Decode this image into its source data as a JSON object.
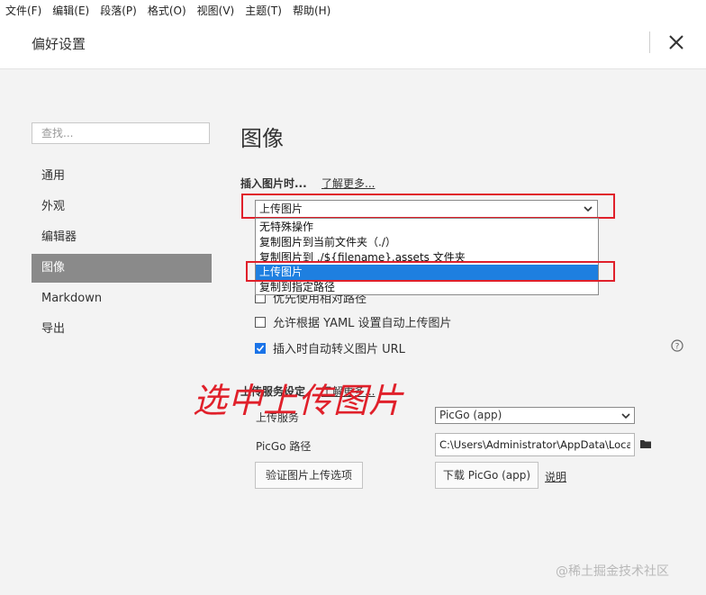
{
  "menubar": {
    "items": [
      "文件(F)",
      "编辑(E)",
      "段落(P)",
      "格式(O)",
      "视图(V)",
      "主题(T)",
      "帮助(H)"
    ]
  },
  "header": {
    "title": "偏好设置",
    "close_icon": "close-icon"
  },
  "sidebar": {
    "search_placeholder": "查找...",
    "items": [
      {
        "label": "通用",
        "active": false
      },
      {
        "label": "外观",
        "active": false
      },
      {
        "label": "编辑器",
        "active": false
      },
      {
        "label": "图像",
        "active": true
      },
      {
        "label": "Markdown",
        "active": false
      },
      {
        "label": "导出",
        "active": false
      }
    ]
  },
  "main": {
    "title": "图像",
    "insert_label": "插入图片时...",
    "learn_more": "了解更多...",
    "insert_select_value": "上传图片",
    "dropdown_options": [
      {
        "label": "无特殊操作",
        "selected": false
      },
      {
        "label": "复制图片到当前文件夹（./）",
        "selected": false
      },
      {
        "label": "复制图片到 ./${filename}.assets 文件夹",
        "selected": false
      },
      {
        "label": "上传图片",
        "selected": true
      },
      {
        "label": "复制到指定路径",
        "selected": false
      }
    ],
    "checkbox_partial_text": "优先使用相对路径",
    "checkbox_yaml": {
      "label": "允许根据 YAML 设置自动上传图片",
      "checked": false
    },
    "checkbox_escape": {
      "label": "插入时自动转义图片 URL",
      "checked": true
    },
    "help_icon": "question-circle-icon",
    "upload_section": {
      "title": "上传服务设定",
      "learn_more": "了解更多...",
      "service_label": "上传服务",
      "service_value": "PicGo (app)",
      "path_label": "PicGo 路径",
      "path_value": "C:\\Users\\Administrator\\AppData\\Local\\P",
      "verify_button": "验证图片上传选项",
      "download_button": "下载 PicGo (app)",
      "explain_link": "说明"
    }
  },
  "annotation": "选中上传图片",
  "watermark": "@稀土掘金技术社区",
  "colors": {
    "highlight_red": "#e0202a",
    "selected_blue": "#1e7fe0",
    "sidebar_active": "#8a8a8a",
    "checkbox_blue": "#1a73e8"
  }
}
